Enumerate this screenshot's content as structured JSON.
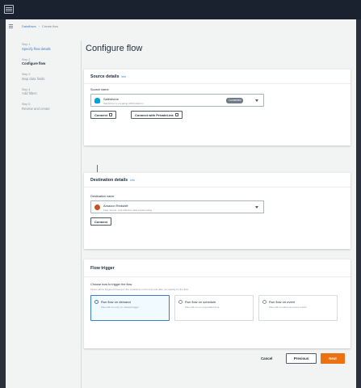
{
  "breadcrumb": {
    "root": "Dataflows",
    "current": "Create flow"
  },
  "steps": [
    {
      "num": "Step 1",
      "label": "Specify flow details",
      "state": "done"
    },
    {
      "num": "Step 2",
      "label": "Configure flow",
      "state": "active"
    },
    {
      "num": "Step 3",
      "label": "Map data fields",
      "state": "pending"
    },
    {
      "num": "Step 4",
      "label": "Add filters",
      "state": "pending"
    },
    {
      "num": "Step 5",
      "label": "Review and create",
      "state": "pending"
    }
  ],
  "page_title": "Configure flow",
  "source": {
    "heading": "Source details",
    "info": "Info",
    "name_label": "Source name",
    "selected_title": "Salesforce",
    "selected_desc": "Salesforce is a leading CRM platform",
    "badge": "Connected",
    "connect_button": "Connect",
    "privatelink_button": "Connect with PrivateLink"
  },
  "destination": {
    "heading": "Destination details",
    "info": "Info",
    "name_label": "Destination name",
    "selected_title": "Amazon Redshift",
    "selected_desc": "Fast, simple, cost-effective data warehousing",
    "connect_button": "Connect"
  },
  "trigger": {
    "heading": "Flow trigger",
    "question": "Choose how to trigger the flow",
    "hint": "Flows will be triggered based on the conditions or the time and date you specify for the flow.",
    "options": [
      {
        "title": "Run flow on demand",
        "desc": "Flow will run only on manual trigger",
        "selected": true
      },
      {
        "title": "Run flow on schedule",
        "desc": "Flow will run on a specified time",
        "selected": false
      },
      {
        "title": "Run flow on event",
        "desc": "Flow will run when an event occurs",
        "selected": false
      }
    ]
  },
  "footer": {
    "cancel": "Cancel",
    "previous": "Previous",
    "next": "Next"
  },
  "colors": {
    "accent": "#ec7211",
    "link": "#3b7dc4",
    "topbar": "#1a2230",
    "salesforce_icon": "#00a1e0",
    "redshift_icon": "#c7511f"
  }
}
